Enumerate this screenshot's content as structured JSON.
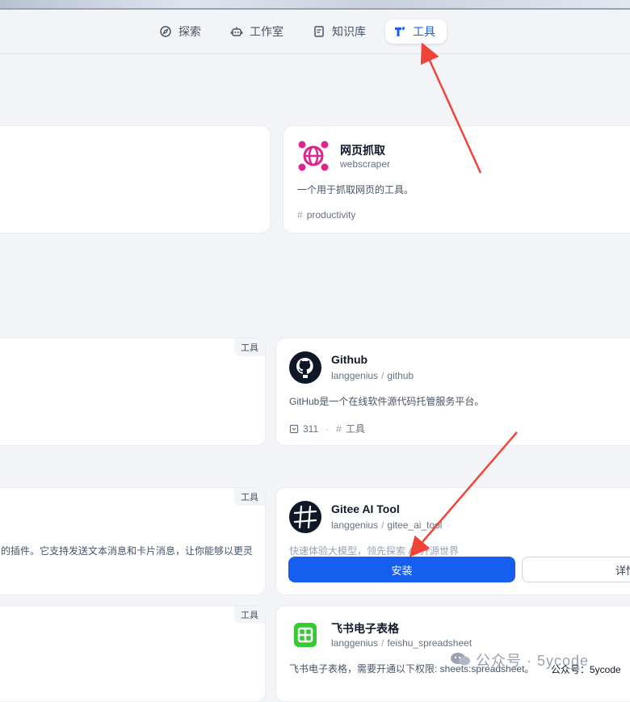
{
  "nav": {
    "items": [
      {
        "label": "探索",
        "icon": "compass-icon"
      },
      {
        "label": "工作室",
        "icon": "robot-icon"
      },
      {
        "label": "知识库",
        "icon": "book-icon"
      },
      {
        "label": "工具",
        "icon": "tool-icon"
      }
    ],
    "active": "工具"
  },
  "top_card": {
    "title": "网页抓取",
    "subtitle": "webscraper",
    "desc": "一个用于抓取网页的工具。",
    "tag": "productivity",
    "icon_color": "#dd2590"
  },
  "cards": [
    {
      "title": "Github",
      "org": "langgenius",
      "name": "github",
      "desc": "GitHub是一个在线软件源代码托管服务平台。",
      "installs": "311",
      "tag": "工具"
    },
    {
      "title": "Gitee AI Tool",
      "org": "langgenius",
      "name": "gitee_ai_tool",
      "desc": "快速体验大模型，领先探索 AI 开源世界"
    },
    {
      "title": "飞书电子表格",
      "org": "langgenius",
      "name": "feishu_spreadsheet",
      "desc": "飞书电子表格，需要开通以下权限: sheets:spreadsheet。"
    }
  ],
  "left_cards": {
    "badge": "工具",
    "desc_partial": "的插件。它支持发送文本消息和卡片消息，让你能够以更灵"
  },
  "buttons": {
    "install": "安装",
    "detail": "详情"
  },
  "separators": {
    "slash": "/",
    "dot": "·",
    "hash": "#"
  },
  "watermark": {
    "main": "公众号 · 5ycode",
    "small": "公众号：5ycode"
  },
  "colors": {
    "accent": "#155eef",
    "arrow": "#f04438",
    "feishu": "#36c930"
  }
}
